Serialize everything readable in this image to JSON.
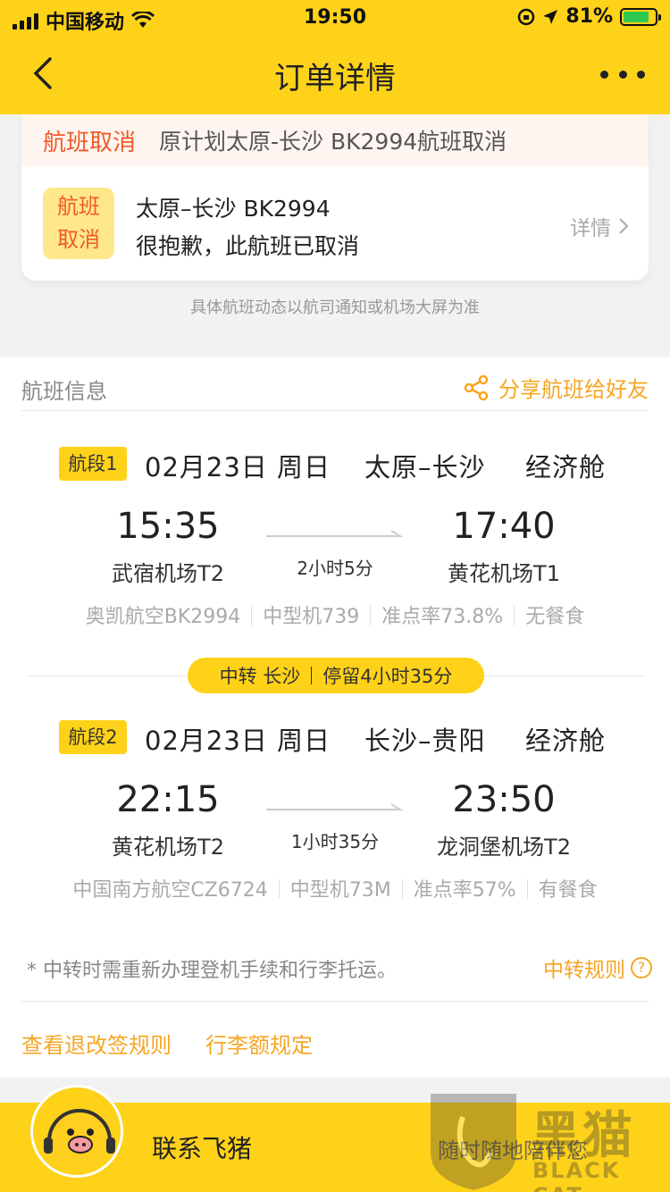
{
  "status_bar": {
    "carrier": "中国移动",
    "time": "19:50",
    "battery": "81%"
  },
  "nav": {
    "title": "订单详情"
  },
  "cancel_notice": {
    "tag": "航班取消",
    "text": "原计划太原-长沙 BK2994航班取消"
  },
  "cancel_card": {
    "badge_line1": "航班",
    "badge_line2": "取消",
    "route": "太原–长沙 BK2994",
    "message": "很抱歉，此航班已取消",
    "detail_link": "详情"
  },
  "hint": "具体航班动态以航司通知或机场大屏为准",
  "flight_info": {
    "title": "航班信息",
    "share": "分享航班给好友"
  },
  "segments": [
    {
      "badge": "航段1",
      "date": "02月23日 周日",
      "route": "太原–长沙",
      "cabin": "经济舱",
      "dep_time": "15:35",
      "dep_airport": "武宿机场T2",
      "arr_time": "17:40",
      "arr_airport": "黄花机场T1",
      "duration": "2小时5分",
      "airline": "奥凯航空BK2994",
      "aircraft": "中型机739",
      "ontime": "准点率73.8%",
      "meal": "无餐食"
    },
    {
      "badge": "航段2",
      "date": "02月23日 周日",
      "route": "长沙–贵阳",
      "cabin": "经济舱",
      "dep_time": "22:15",
      "dep_airport": "黄花机场T2",
      "arr_time": "23:50",
      "arr_airport": "龙洞堡机场T2",
      "duration": "1小时35分",
      "airline": "中国南方航空CZ6724",
      "aircraft": "中型机73M",
      "ontime": "准点率57%",
      "meal": "有餐食"
    }
  ],
  "transfer": {
    "city": "中转 长沙",
    "stay": "停留4小时35分"
  },
  "transfer_note": "* 中转时需重新办理登机手续和行李托运。",
  "transfer_rules": "中转规则",
  "links": {
    "refund_rules": "查看退改签规则",
    "baggage": "行李额规定"
  },
  "contact": {
    "label": "联系飞猪",
    "slogan": "随时随地陪伴您"
  },
  "watermark": {
    "brand": "黑猫",
    "brand_en": "BLACK CAT"
  },
  "colors": {
    "brand_yellow": "#ffd21a",
    "accent_orange": "#f5a623",
    "cancel_red": "#f05a28"
  }
}
